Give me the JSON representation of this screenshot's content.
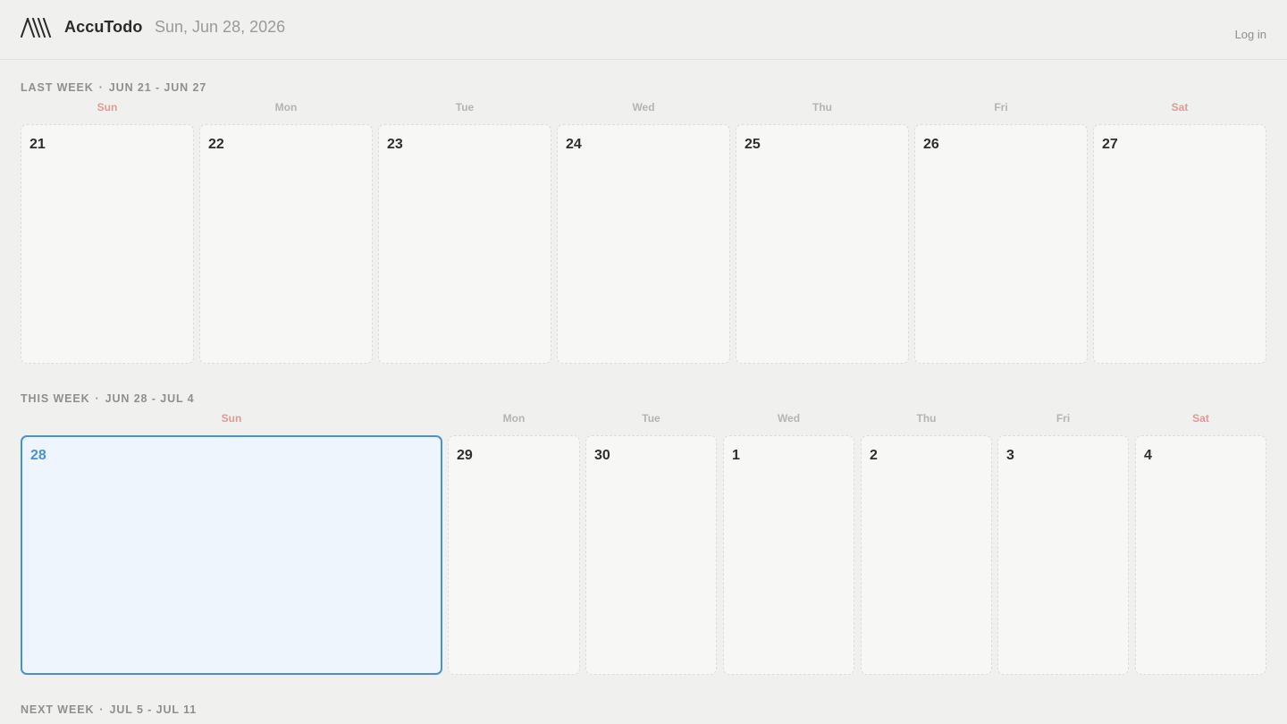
{
  "header": {
    "app_name": "AccuTodo",
    "date": "Sun, Jun 28, 2026",
    "login_label": "Log in"
  },
  "weeks": [
    {
      "label": "LAST WEEK",
      "range": "JUN 21 - JUN 27",
      "days": [
        {
          "name": "Sun",
          "num": "21"
        },
        {
          "name": "Mon",
          "num": "22"
        },
        {
          "name": "Tue",
          "num": "23"
        },
        {
          "name": "Wed",
          "num": "24"
        },
        {
          "name": "Thu",
          "num": "25"
        },
        {
          "name": "Fri",
          "num": "26"
        },
        {
          "name": "Sat",
          "num": "27"
        }
      ]
    },
    {
      "label": "THIS WEEK",
      "range": "JUN 28 - JUL 4",
      "days": [
        {
          "name": "Sun",
          "num": "28",
          "today": true
        },
        {
          "name": "Mon",
          "num": "29"
        },
        {
          "name": "Tue",
          "num": "30"
        },
        {
          "name": "Wed",
          "num": "1"
        },
        {
          "name": "Thu",
          "num": "2"
        },
        {
          "name": "Fri",
          "num": "3"
        },
        {
          "name": "Sat",
          "num": "4"
        }
      ]
    },
    {
      "label": "NEXT WEEK",
      "range": "JUL 5 - JUL 11"
    }
  ],
  "colors": {
    "accent": "#4a90d9",
    "weekend": "#e09a94",
    "background": "#f0f1ef"
  }
}
